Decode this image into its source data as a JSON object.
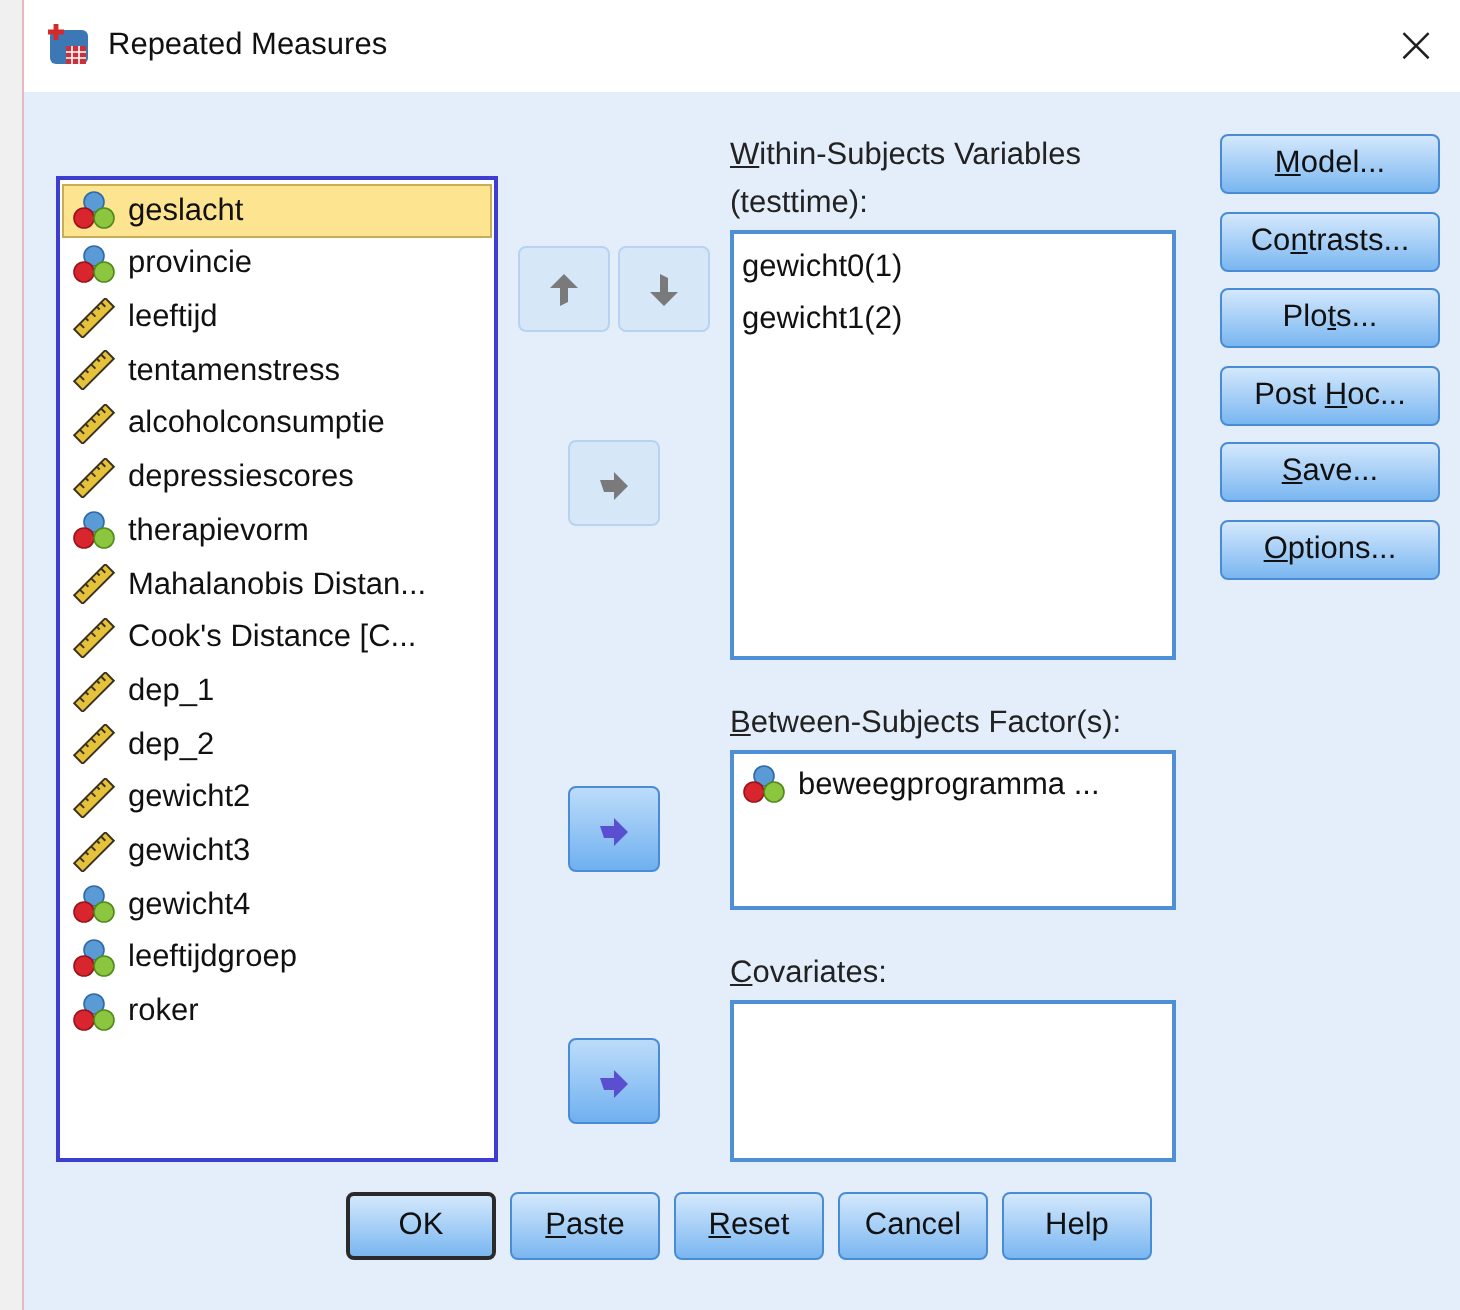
{
  "window": {
    "title": "Repeated Measures",
    "close": "×"
  },
  "variables": [
    {
      "name": "geslacht",
      "kind": "nominal",
      "selected": true
    },
    {
      "name": "provincie",
      "kind": "nominal",
      "selected": false
    },
    {
      "name": "leeftijd",
      "kind": "scale",
      "selected": false
    },
    {
      "name": "tentamenstress",
      "kind": "scale",
      "selected": false
    },
    {
      "name": "alcoholconsumptie",
      "kind": "scale",
      "selected": false
    },
    {
      "name": "depressiescores",
      "kind": "scale",
      "selected": false
    },
    {
      "name": "therapievorm",
      "kind": "nominal",
      "selected": false
    },
    {
      "name": "Mahalanobis Distan...",
      "kind": "scale",
      "selected": false
    },
    {
      "name": "Cook's Distance [C...",
      "kind": "scale",
      "selected": false
    },
    {
      "name": "dep_1",
      "kind": "scale",
      "selected": false
    },
    {
      "name": "dep_2",
      "kind": "scale",
      "selected": false
    },
    {
      "name": "gewicht2",
      "kind": "scale",
      "selected": false
    },
    {
      "name": "gewicht3",
      "kind": "scale",
      "selected": false
    },
    {
      "name": "gewicht4",
      "kind": "nominal",
      "selected": false
    },
    {
      "name": "leeftijdgroep",
      "kind": "nominal",
      "selected": false
    },
    {
      "name": "roker",
      "kind": "nominal",
      "selected": false
    }
  ],
  "order_buttons": [
    {
      "kind": "up",
      "disabled": true
    },
    {
      "kind": "down",
      "disabled": true
    }
  ],
  "within_subjects": {
    "label": [
      {
        "text": "W",
        "underline": true
      },
      {
        "text": "ithin-Subjects Variables",
        "underline": false
      }
    ],
    "label_line2": "(testtime):",
    "move_disabled": true,
    "items": [
      {
        "name": "gewicht0(1)"
      },
      {
        "name": "gewicht1(2)"
      }
    ]
  },
  "between_subjects": {
    "label": [
      {
        "text": "B",
        "underline": true
      },
      {
        "text": "etween-Subjects Factor(s):",
        "underline": false
      }
    ],
    "move_disabled": false,
    "items": [
      {
        "name": "beweegprogramma ...",
        "kind": "nominal"
      }
    ]
  },
  "covariates": {
    "label": [
      {
        "text": "C",
        "underline": true
      },
      {
        "text": "ovariates:",
        "underline": false
      }
    ],
    "move_disabled": false
  },
  "side_buttons": [
    {
      "label": [
        {
          "text": "M",
          "underline": true
        },
        {
          "text": "odel...",
          "underline": false
        }
      ]
    },
    {
      "label": [
        {
          "text": "Co",
          "underline": false
        },
        {
          "text": "n",
          "underline": true
        },
        {
          "text": "trasts...",
          "underline": false
        }
      ]
    },
    {
      "label": [
        {
          "text": "Plo",
          "underline": false
        },
        {
          "text": "t",
          "underline": true
        },
        {
          "text": "s...",
          "underline": false
        }
      ]
    },
    {
      "label": [
        {
          "text": "Post ",
          "underline": false
        },
        {
          "text": "H",
          "underline": true
        },
        {
          "text": "oc...",
          "underline": false
        }
      ]
    },
    {
      "label": [
        {
          "text": "S",
          "underline": true
        },
        {
          "text": "ave...",
          "underline": false
        }
      ]
    },
    {
      "label": [
        {
          "text": "O",
          "underline": true
        },
        {
          "text": "ptions...",
          "underline": false
        }
      ]
    }
  ],
  "bottom_buttons": [
    {
      "label": [
        {
          "text": "OK",
          "underline": false
        }
      ],
      "default": true
    },
    {
      "label": [
        {
          "text": "P",
          "underline": true
        },
        {
          "text": "aste",
          "underline": false
        }
      ],
      "default": false
    },
    {
      "label": [
        {
          "text": "R",
          "underline": true
        },
        {
          "text": "eset",
          "underline": false
        }
      ],
      "default": false
    },
    {
      "label": [
        {
          "text": "Cancel",
          "underline": false
        }
      ],
      "default": false
    },
    {
      "label": [
        {
          "text": "Help",
          "underline": false
        }
      ],
      "default": false
    }
  ]
}
